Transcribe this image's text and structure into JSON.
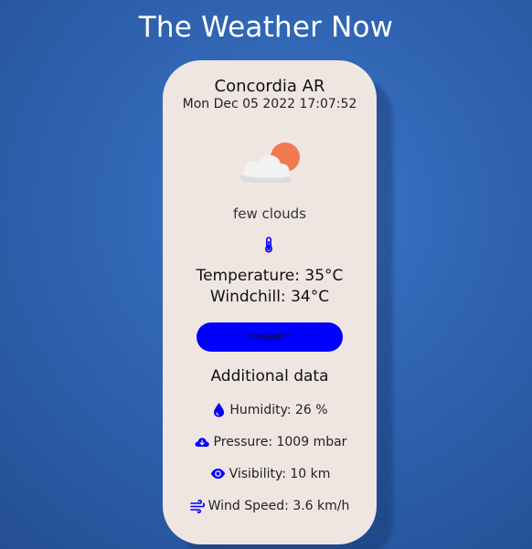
{
  "page": {
    "title": "The Weather Now"
  },
  "card": {
    "city": "Concordia AR",
    "date": "Mon Dec 05 2022 17:07:52",
    "description": "few clouds",
    "weather_icon": "few-clouds-icon",
    "temperature": "Temperature: 35°C",
    "windchill": "Windchill: 34°C",
    "convert_label": "Convert °",
    "additional_title": "Additional data",
    "details": {
      "humidity": "Humidity: 26 %",
      "pressure": "Pressure: 1009 mbar",
      "visibility": "Visibility: 10 km",
      "wind_speed": "Wind Speed: 3.6 km/h"
    }
  },
  "colors": {
    "background": "#3369b8",
    "card": "#efe6e2",
    "accent": "#0000ff",
    "sun": "#f07a50",
    "cloud": "#f1f1f1"
  }
}
